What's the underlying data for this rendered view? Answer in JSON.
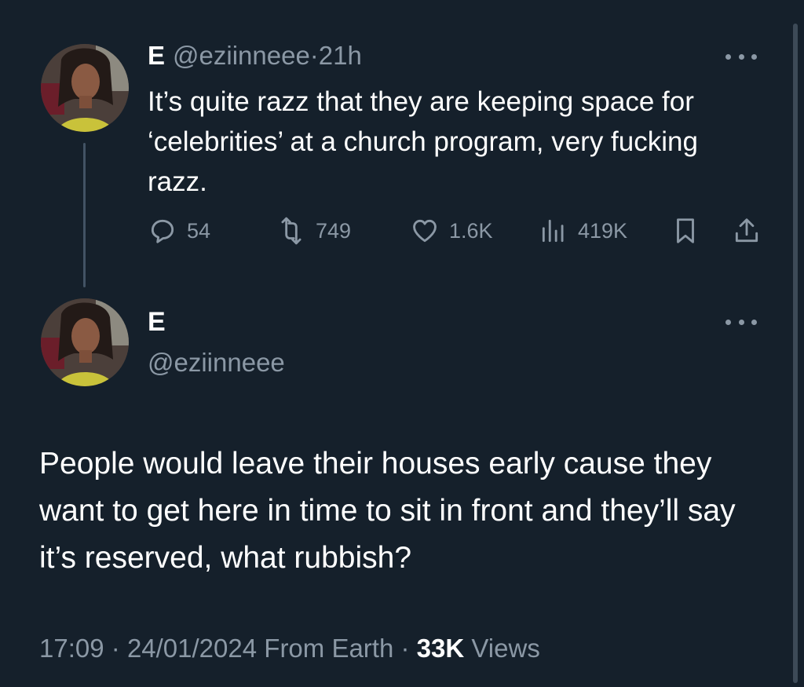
{
  "reply_tweet": {
    "name": "E",
    "handle": "@eziinneee",
    "separator": "·",
    "time": "21h",
    "text": "It’s quite razz that they are keeping space for ‘celebrities’ at a church program, very fucking razz.",
    "actions": {
      "replies": "54",
      "retweets": "749",
      "likes": "1.6K",
      "views": "419K"
    },
    "icons": [
      "reply-icon",
      "retweet-icon",
      "like-icon",
      "views-icon",
      "bookmark-icon",
      "share-icon"
    ]
  },
  "main_tweet": {
    "name": "E",
    "handle": "@eziinneee",
    "text": "People would leave their houses early cause they want to get here in time to sit in front and they’ll say it’s reserved, what rubbish?",
    "time": "17:09",
    "date": "24/01/2024",
    "source": "From Earth",
    "separator": "·",
    "views_count": "33K",
    "views_label": "Views"
  },
  "colors": {
    "background": "#15202b",
    "text_primary": "#ffffff",
    "text_secondary": "#8b98a5",
    "thread_line": "#425364"
  }
}
